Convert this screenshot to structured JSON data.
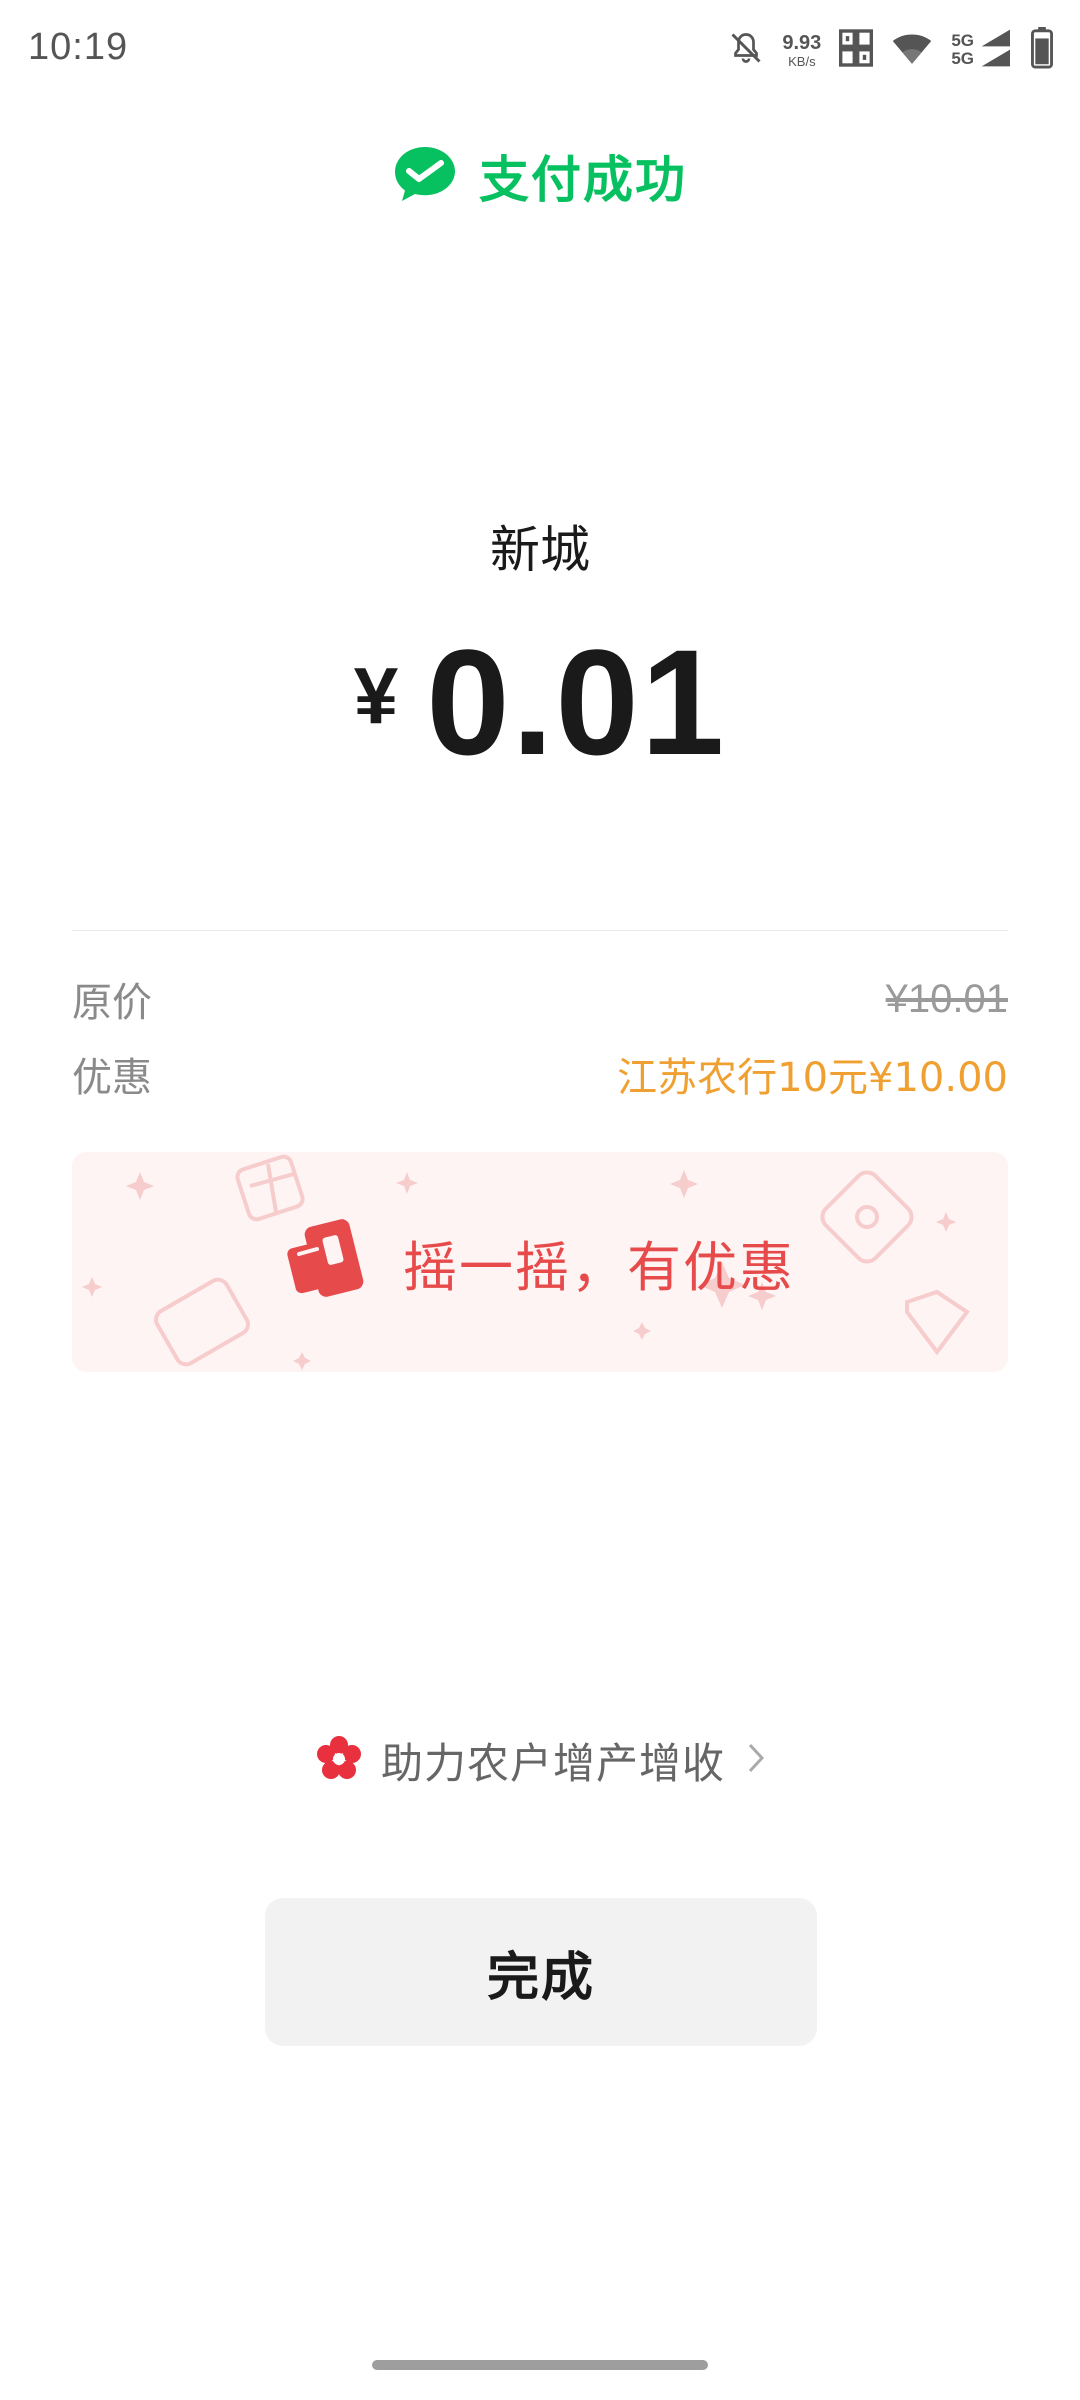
{
  "status_bar": {
    "time": "10:19",
    "net_speed_value": "9.93",
    "net_speed_unit": "KB/s",
    "sim_top": "5G",
    "sim_bottom": "5G",
    "icons": [
      "bell-off-icon",
      "nfc-icon",
      "wifi-icon",
      "cellular-signal-icon",
      "battery-icon"
    ]
  },
  "header": {
    "title": "支付成功",
    "icon": "wechat-pay-icon",
    "accent_color": "#07c160"
  },
  "payment": {
    "merchant": "新城",
    "currency_symbol": "¥",
    "amount": "0.01"
  },
  "details": {
    "original_price_label": "原价",
    "original_price_value": "¥10.01",
    "discount_label": "优惠",
    "discount_value": "江苏农行10元¥10.00",
    "discount_color": "#f0a030"
  },
  "promo": {
    "text": "摇一摇，有优惠",
    "icon": "shake-phone-icon",
    "color": "#e74a4a"
  },
  "help_link": {
    "text": "助力农户增产增收",
    "icon": "red-flower-icon"
  },
  "done_button": {
    "label": "完成"
  }
}
